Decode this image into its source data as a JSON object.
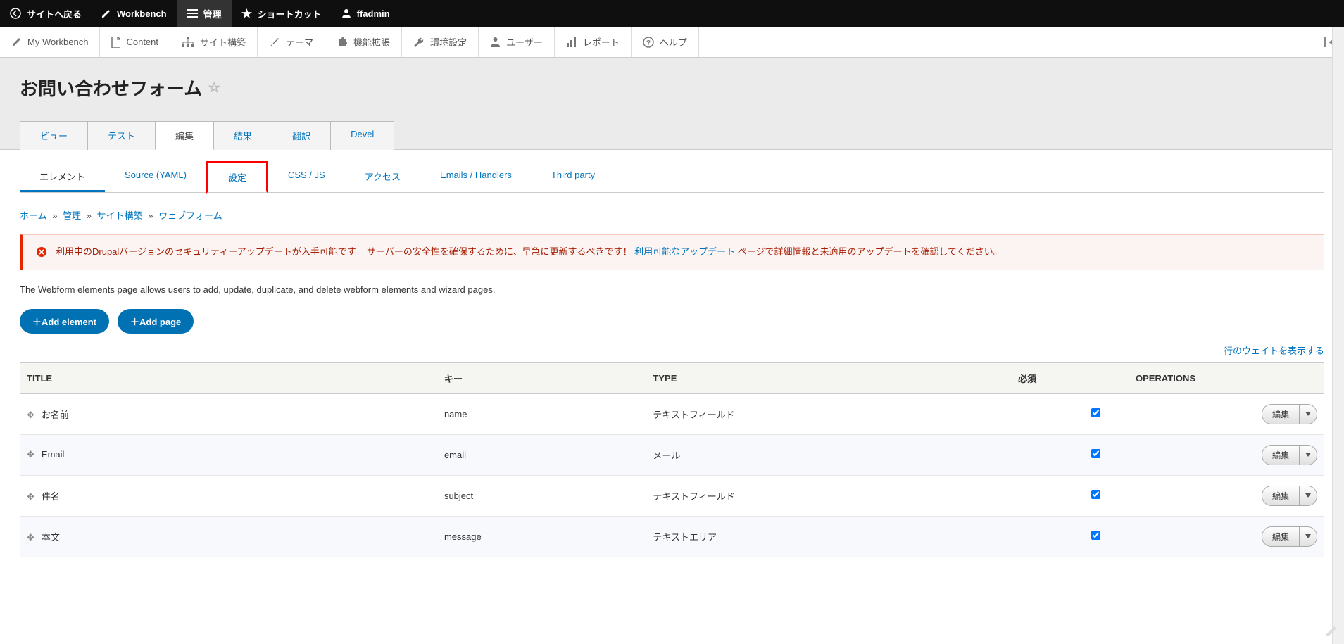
{
  "toolbar": {
    "back": "サイトへ戻る",
    "workbench": "Workbench",
    "manage": "管理",
    "shortcuts": "ショートカット",
    "user": "ffadmin"
  },
  "menubar": {
    "my_workbench": "My Workbench",
    "content": "Content",
    "structure": "サイト構築",
    "appearance": "テーマ",
    "extend": "機能拡張",
    "config": "環境設定",
    "people": "ユーザー",
    "reports": "レポート",
    "help": "ヘルプ"
  },
  "page_title": "お問い合わせフォーム",
  "primary_tabs": [
    {
      "key": "view",
      "label": "ビュー",
      "active": false
    },
    {
      "key": "test",
      "label": "テスト",
      "active": false
    },
    {
      "key": "edit",
      "label": "編集",
      "active": true
    },
    {
      "key": "results",
      "label": "結果",
      "active": false
    },
    {
      "key": "translate",
      "label": "翻訳",
      "active": false
    },
    {
      "key": "devel",
      "label": "Devel",
      "active": false
    }
  ],
  "secondary_tabs": [
    {
      "key": "elements",
      "label": "エレメント",
      "active": true,
      "highlight": false
    },
    {
      "key": "source",
      "label": "Source (YAML)",
      "active": false,
      "highlight": false
    },
    {
      "key": "settings",
      "label": "設定",
      "active": false,
      "highlight": true
    },
    {
      "key": "cssjs",
      "label": "CSS / JS",
      "active": false,
      "highlight": false
    },
    {
      "key": "access",
      "label": "アクセス",
      "active": false,
      "highlight": false
    },
    {
      "key": "emails",
      "label": "Emails / Handlers",
      "active": false,
      "highlight": false
    },
    {
      "key": "thirdparty",
      "label": "Third party",
      "active": false,
      "highlight": false
    }
  ],
  "breadcrumb": {
    "home": "ホーム",
    "admin": "管理",
    "structure": "サイト構築",
    "webform": "ウェブフォーム"
  },
  "alert": {
    "text_before_link": "利用中のDrupalバージョンのセキュリティーアップデートが入手可能です。 サーバーの安全性を確保するために、早急に更新するべきです！ ",
    "link_text": "利用可能なアップデート",
    "text_after_link": " ページで詳細情報と未適用のアップデートを確認してください。"
  },
  "description": "The Webform elements page allows users to add, update, duplicate, and delete webform elements and wizard pages.",
  "buttons": {
    "add_element": "＋Add element",
    "add_page": "＋Add page"
  },
  "show_weights": "行のウェイトを表示する",
  "table": {
    "headers": {
      "title": "TITLE",
      "key": "キー",
      "type": "TYPE",
      "required": "必須",
      "operations": "OPERATIONS"
    },
    "rows": [
      {
        "title": "お名前",
        "key": "name",
        "type": "テキストフィールド",
        "required": true
      },
      {
        "title": "Email",
        "key": "email",
        "type": "メール",
        "required": true
      },
      {
        "title": "件名",
        "key": "subject",
        "type": "テキストフィールド",
        "required": true
      },
      {
        "title": "本文",
        "key": "message",
        "type": "テキストエリア",
        "required": true
      }
    ],
    "edit_label": "編集"
  }
}
